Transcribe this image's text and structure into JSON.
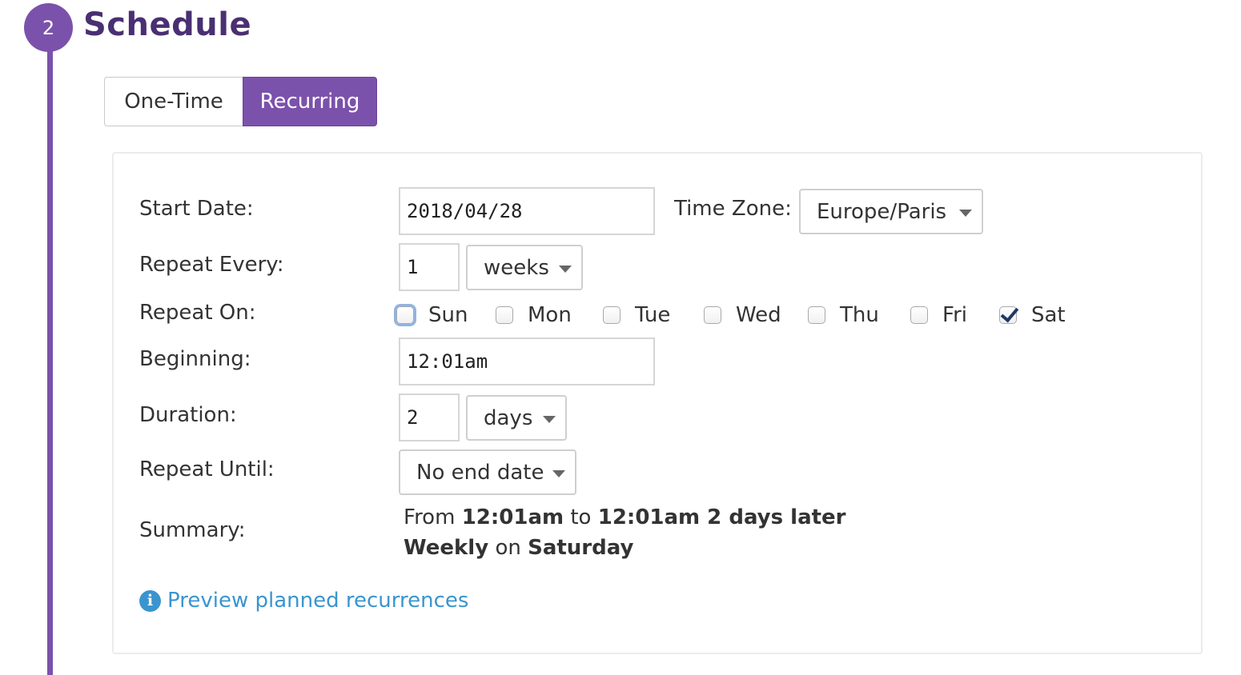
{
  "step": {
    "number": "2",
    "title": "Schedule"
  },
  "mode_toggle": {
    "one_time": "One-Time",
    "recurring": "Recurring",
    "selected": "Recurring"
  },
  "form": {
    "start_date": {
      "label": "Start Date:",
      "value": "2018/04/28"
    },
    "time_zone": {
      "label": "Time Zone:",
      "value": "Europe/Paris"
    },
    "repeat_every": {
      "label": "Repeat Every:",
      "value": "1",
      "unit": "weeks"
    },
    "repeat_on": {
      "label": "Repeat On:",
      "days": [
        {
          "label": "Sun",
          "checked": false,
          "focused": true
        },
        {
          "label": "Mon",
          "checked": false
        },
        {
          "label": "Tue",
          "checked": false
        },
        {
          "label": "Wed",
          "checked": false
        },
        {
          "label": "Thu",
          "checked": false
        },
        {
          "label": "Fri",
          "checked": false
        },
        {
          "label": "Sat",
          "checked": true
        }
      ]
    },
    "beginning": {
      "label": "Beginning:",
      "value": "12:01am"
    },
    "duration": {
      "label": "Duration:",
      "value": "2",
      "unit": "days"
    },
    "repeat_until": {
      "label": "Repeat Until:",
      "value": "No end date"
    },
    "summary": {
      "label": "Summary:",
      "from": "From",
      "start_time": "12:01am",
      "to": "to",
      "end": "12:01am 2 days later",
      "frequency": "Weekly",
      "on": "on",
      "day": "Saturday"
    }
  },
  "preview_link": {
    "label": "Preview planned recurrences",
    "icon": "info-circle-icon"
  },
  "colors": {
    "accent": "#7b52ab",
    "title": "#4a2f73",
    "link": "#3a95cf"
  }
}
